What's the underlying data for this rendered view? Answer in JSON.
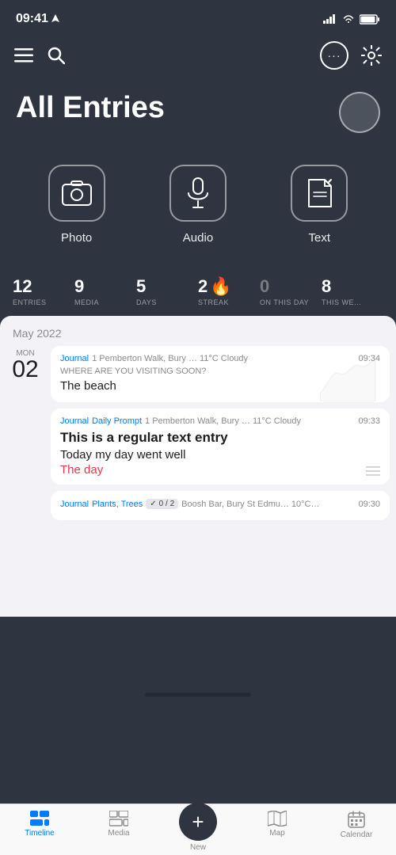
{
  "statusBar": {
    "time": "09:41",
    "hasLocation": true
  },
  "header": {
    "title": "All Entries"
  },
  "entryButtons": [
    {
      "id": "photo",
      "label": "Photo"
    },
    {
      "id": "audio",
      "label": "Audio"
    },
    {
      "id": "text",
      "label": "Text"
    }
  ],
  "stats": [
    {
      "value": "12",
      "label": "ENTRIES"
    },
    {
      "value": "9",
      "label": "MEDIA"
    },
    {
      "value": "5",
      "label": "DAYS"
    },
    {
      "value": "2",
      "label": "STREAK",
      "hasFlame": true
    },
    {
      "value": "0",
      "label": "ON THIS DAY",
      "dim": true
    },
    {
      "value": "8",
      "label": "THIS WE…"
    }
  ],
  "timeline": {
    "monthLabel": "May 2022",
    "dateDay": "MON",
    "dateDayNum": "02",
    "entries": [
      {
        "id": "entry1",
        "journal": "Journal",
        "location": "1 Pemberton Walk, Bury … 11°C Cloudy",
        "time": "09:34",
        "prompt": "WHERE ARE YOU VISITING SOON?",
        "title": "",
        "body": "The beach",
        "bodyHighlight": "",
        "hasSparkline": true
      },
      {
        "id": "entry2",
        "journal": "Journal",
        "journalSub": "Daily Prompt",
        "location": "1 Pemberton Walk, Bury … 11°C Cloudy",
        "time": "09:33",
        "prompt": "",
        "title": "This is a regular text entry",
        "body": "Today my day went well",
        "bodyHighlight": "The day",
        "hasLines": true
      },
      {
        "id": "entry3",
        "journal": "Journal",
        "journalSub": "Plants, Trees",
        "location": "Boosh Bar, Bury St Edmu… 10°C…",
        "time": "09:30",
        "tag": "0 / 2",
        "prompt": "",
        "title": "",
        "body": ""
      }
    ]
  },
  "bottomNav": [
    {
      "id": "timeline",
      "label": "Timeline",
      "active": true
    },
    {
      "id": "media",
      "label": "Media",
      "active": false
    },
    {
      "id": "new",
      "label": "New",
      "active": false,
      "isNew": true
    },
    {
      "id": "map",
      "label": "Map",
      "active": false
    },
    {
      "id": "calendar",
      "label": "Calendar",
      "active": false
    }
  ]
}
